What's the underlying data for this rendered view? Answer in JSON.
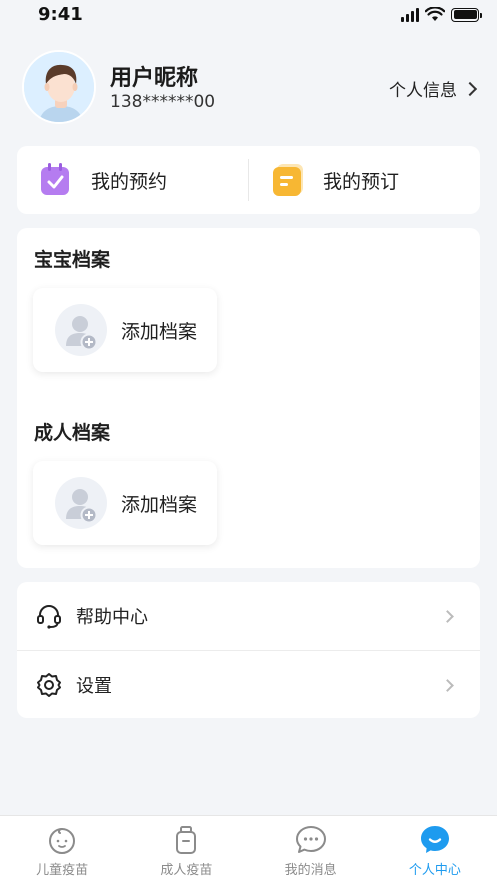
{
  "status_bar": {
    "time": "9:41"
  },
  "profile": {
    "nickname": "用户昵称",
    "phone": "138******00",
    "info_link": "个人信息"
  },
  "quick_actions": [
    {
      "label": "我的预约",
      "icon": "calendar-check-icon",
      "color": "#b57cf0"
    },
    {
      "label": "我的预订",
      "icon": "order-note-icon",
      "color": "#f7b733"
    }
  ],
  "archives": {
    "baby": {
      "title": "宝宝档案",
      "add_label": "添加档案"
    },
    "adult": {
      "title": "成人档案",
      "add_label": "添加档案"
    }
  },
  "menu": [
    {
      "label": "帮助中心",
      "icon": "headset-icon"
    },
    {
      "label": "设置",
      "icon": "gear-icon"
    }
  ],
  "tabs": [
    {
      "label": "儿童疫苗",
      "icon": "baby-face-icon",
      "active": false
    },
    {
      "label": "成人疫苗",
      "icon": "vaccine-bottle-icon",
      "active": false
    },
    {
      "label": "我的消息",
      "icon": "chat-bubble-icon",
      "active": false
    },
    {
      "label": "个人中心",
      "icon": "profile-smile-icon",
      "active": true
    }
  ],
  "colors": {
    "accent": "#1e9bef",
    "background": "#f3f5f8"
  }
}
